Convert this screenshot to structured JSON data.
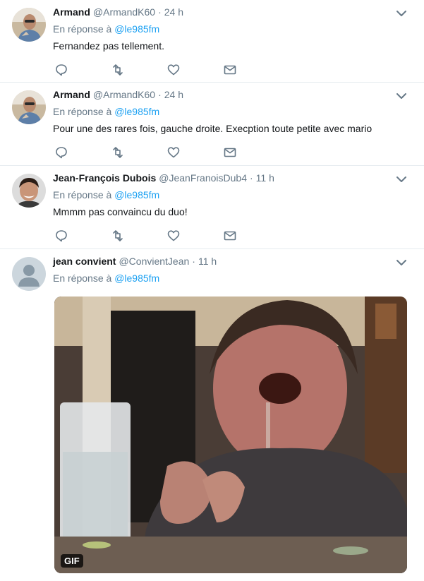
{
  "colors": {
    "link": "#1da1f2",
    "secondary_text": "#657786",
    "primary_text": "#14171a",
    "divider": "#e6ecf0"
  },
  "tweets": [
    {
      "name": "Armand",
      "handle": "@ArmandK60",
      "dot": "·",
      "time": "24 h",
      "reply_prefix": "En réponse à",
      "reply_to": "@le985fm",
      "text": "Fernandez pas tellement."
    },
    {
      "name": "Armand",
      "handle": "@ArmandK60",
      "dot": "·",
      "time": "24 h",
      "reply_prefix": "En réponse à",
      "reply_to": "@le985fm",
      "text": "Pour une des rares fois, gauche droite. Execption toute petite avec mario"
    },
    {
      "name": "Jean-François Dubois",
      "handle": "@JeanFranoisDub4",
      "dot": "·",
      "time": "11 h",
      "reply_prefix": "En réponse à",
      "reply_to": "@le985fm",
      "text": "Mmmm pas convaincu du duo!"
    },
    {
      "name": "jean convient",
      "handle": "@ConvientJean",
      "dot": "·",
      "time": "11 h",
      "reply_prefix": "En réponse à",
      "reply_to": "@le985fm",
      "media_badge": "GIF"
    }
  ],
  "icons": {
    "caret": "chevron-down-icon",
    "reply": "reply-icon",
    "retweet": "retweet-icon",
    "like": "heart-icon",
    "dm": "envelope-icon"
  }
}
